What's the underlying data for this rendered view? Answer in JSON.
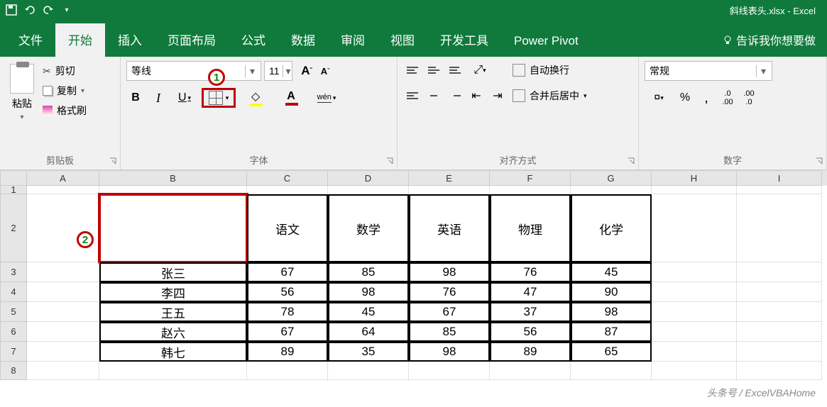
{
  "title": "斜线表头.xlsx - Excel",
  "tabs": {
    "file": "文件",
    "home": "开始",
    "insert": "插入",
    "layout": "页面布局",
    "formulas": "公式",
    "data": "数据",
    "review": "审阅",
    "view": "视图",
    "developer": "开发工具",
    "powerpivot": "Power Pivot",
    "tellme": "告诉我你想要做"
  },
  "ribbon": {
    "clipboard": {
      "label": "剪贴板",
      "paste": "粘贴",
      "cut": "剪切",
      "copy": "复制",
      "format_painter": "格式刷"
    },
    "font": {
      "label": "字体",
      "name": "等线",
      "size": "11",
      "bold": "B",
      "italic": "I",
      "underline": "U",
      "wen": "wén"
    },
    "alignment": {
      "label": "对齐方式",
      "wrap": "自动换行",
      "merge": "合并后居中"
    },
    "number": {
      "label": "数字",
      "format": "常规",
      "percent": "%",
      "comma": ",",
      "inc": ".0",
      "dec": ".00"
    }
  },
  "callouts": {
    "c1": "1",
    "c2": "2"
  },
  "columns": [
    "A",
    "B",
    "C",
    "D",
    "E",
    "F",
    "G",
    "H",
    "I"
  ],
  "rownums": [
    "1",
    "2",
    "3",
    "4",
    "5",
    "6",
    "7",
    "8"
  ],
  "table": {
    "headers": [
      "语文",
      "数学",
      "英语",
      "物理",
      "化学"
    ],
    "rows": [
      {
        "name": "张三",
        "scores": [
          "67",
          "85",
          "98",
          "76",
          "45"
        ]
      },
      {
        "name": "李四",
        "scores": [
          "56",
          "98",
          "76",
          "47",
          "90"
        ]
      },
      {
        "name": "王五",
        "scores": [
          "78",
          "45",
          "67",
          "37",
          "98"
        ]
      },
      {
        "name": "赵六",
        "scores": [
          "67",
          "64",
          "85",
          "56",
          "87"
        ]
      },
      {
        "name": "韩七",
        "scores": [
          "89",
          "35",
          "98",
          "89",
          "65"
        ]
      }
    ]
  },
  "watermark": "头条号 / ExcelVBAHome"
}
